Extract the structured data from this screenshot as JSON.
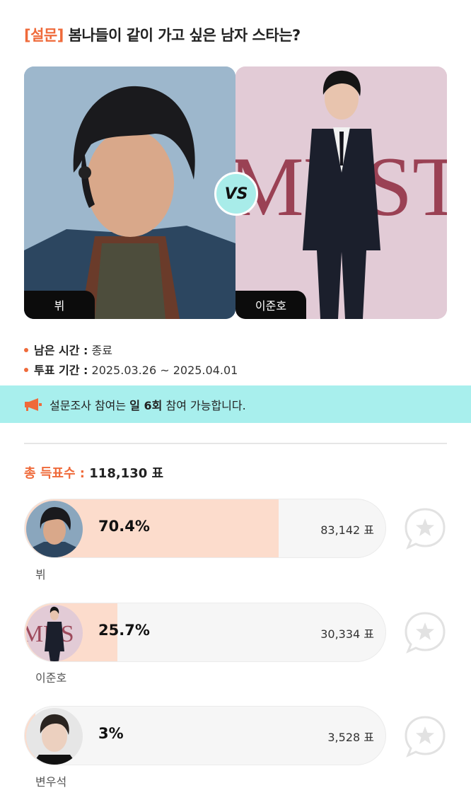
{
  "poll": {
    "tag": "[설문]",
    "question": "봄나들이 같이 가고 싶은 남자 스타는?"
  },
  "versus": {
    "left_name": "뷔",
    "right_name": "이준호",
    "badge": "VS"
  },
  "info": {
    "remaining_label": "남은 시간 :",
    "remaining_value": "종료",
    "period_label": "투표 기간 :",
    "period_value": "2025.03.26 ~ 2025.04.01"
  },
  "notice": {
    "prefix": "설문조사 참여는",
    "emphasis": "일 6회",
    "suffix": "참여 가능합니다."
  },
  "total": {
    "label": "총 득표수 :",
    "value": "118,130 표"
  },
  "results": [
    {
      "name": "뷔",
      "percent_text": "70.4%",
      "share": 0.704,
      "votes": "83,142 표"
    },
    {
      "name": "이준호",
      "percent_text": "25.7%",
      "share": 0.257,
      "votes": "30,334 표"
    },
    {
      "name": "변우석",
      "percent_text": "3%",
      "share": 0.03,
      "votes": "3,528 표"
    }
  ],
  "colors": {
    "accent": "#ef6a3a",
    "notice_bg": "#a8efed",
    "bar_fill": "#fcdccc",
    "star": "#e2e2e2"
  },
  "icons": [
    "megaphone-icon",
    "star-bubble-icon"
  ]
}
